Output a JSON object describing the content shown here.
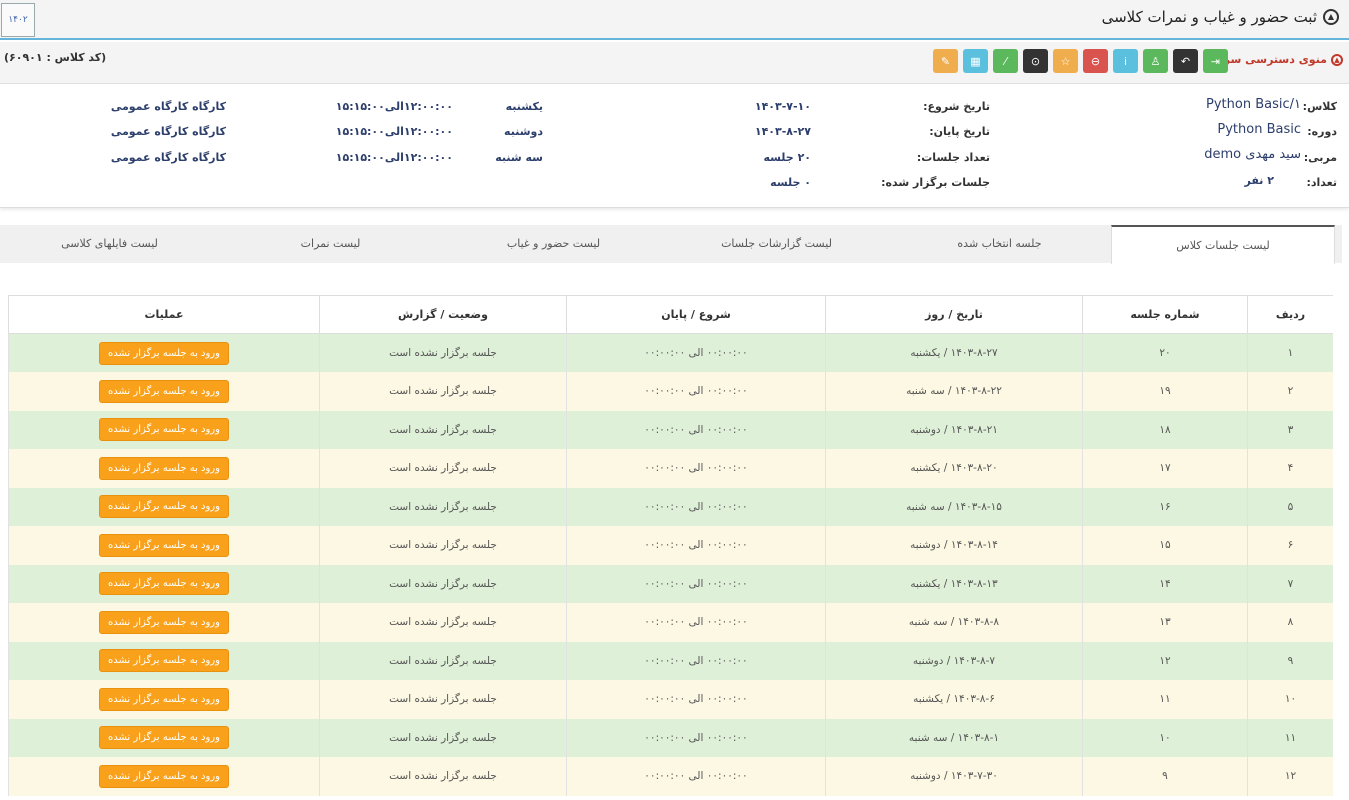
{
  "header": {
    "title": "ثبت حضور و غیاب و نمرات کلاسی",
    "title_icon": "collapse-circle-icon",
    "logo_text": "۱۴۰۲"
  },
  "quick_menu": {
    "label": "منوی دسترسی سریع :",
    "class_code": "(کد کلاس : ۶۰۹۰۱)",
    "buttons": [
      {
        "icon": "sign-in-icon",
        "glyph": "⇥",
        "color": "#5cb85c"
      },
      {
        "icon": "reply-icon",
        "glyph": "↶",
        "color": "#333333"
      },
      {
        "icon": "user-icon",
        "glyph": "♙",
        "color": "#5cb85c"
      },
      {
        "icon": "info-icon",
        "glyph": "i",
        "color": "#5bc0de"
      },
      {
        "icon": "minus-circle-icon",
        "glyph": "⊖",
        "color": "#d9534f"
      },
      {
        "icon": "star-icon",
        "glyph": "☆",
        "color": "#f0ad4e"
      },
      {
        "icon": "clock-icon",
        "glyph": "⊙",
        "color": "#333333"
      },
      {
        "icon": "magic-wand-icon",
        "glyph": "⁄",
        "color": "#5cb85c"
      },
      {
        "icon": "calendar-icon",
        "glyph": "▦",
        "color": "#5bc0de"
      },
      {
        "icon": "edit-icon",
        "glyph": "✎",
        "color": "#f0ad4e"
      }
    ]
  },
  "info": {
    "class_label": "کلاس:",
    "class_value": "Python Basic/۱",
    "course_label": "دوره:",
    "course_value": "Python Basic",
    "teacher_label": "مربی:",
    "teacher_value": "سید مهدی demo",
    "count_label": "تعداد:",
    "count_value": "۲ نفر",
    "start_label": "تاریخ شروع:",
    "start_value": "۱۴۰۳-۷-۱۰",
    "end_label": "تاریخ پایان:",
    "end_value": "۱۴۰۳-۸-۲۷",
    "sessions_label": "تعداد جلسات:",
    "sessions_value": "۲۰ جلسه",
    "held_label": "جلسات برگزار شده:",
    "held_value": "۰ جلسه",
    "schedule": [
      {
        "day": "یکشنبه",
        "time": "۱۲:۰۰:۰۰الی۱۵:۱۵:۰۰",
        "place": "کارگاه کارگاه عمومی"
      },
      {
        "day": "دوشنبه",
        "time": "۱۲:۰۰:۰۰الی۱۵:۱۵:۰۰",
        "place": "کارگاه کارگاه عمومی"
      },
      {
        "day": "سه شنبه",
        "time": "۱۲:۰۰:۰۰الی۱۵:۱۵:۰۰",
        "place": "کارگاه کارگاه عمومی"
      }
    ]
  },
  "tabs": [
    {
      "label": "لیست جلسات کلاس",
      "active": true
    },
    {
      "label": "جلسه انتخاب شده"
    },
    {
      "label": "لیست گزارشات جلسات"
    },
    {
      "label": "لیست حضور و غیاب"
    },
    {
      "label": "لیست نمرات"
    },
    {
      "label": "لیست فایلهای کلاسی"
    }
  ],
  "table": {
    "headers": [
      "ردیف",
      "شماره جلسه",
      "تاریخ / روز",
      "شروع / پایان",
      "وضعیت / گزارش",
      "عملیات"
    ],
    "rows": [
      {
        "row": "۱",
        "num": "۲۰",
        "date": "۱۴۰۳-۸-۲۷ / یکشنبه",
        "time": "۰۰:۰۰:۰۰ الی ۰۰:۰۰:۰۰",
        "status": "جلسه برگزار نشده است",
        "action": "ورود به جلسه برگزار نشده"
      },
      {
        "row": "۲",
        "num": "۱۹",
        "date": "۱۴۰۳-۸-۲۲ / سه شنبه",
        "time": "۰۰:۰۰:۰۰ الی ۰۰:۰۰:۰۰",
        "status": "جلسه برگزار نشده است",
        "action": "ورود به جلسه برگزار نشده"
      },
      {
        "row": "۳",
        "num": "۱۸",
        "date": "۱۴۰۳-۸-۲۱ / دوشنبه",
        "time": "۰۰:۰۰:۰۰ الی ۰۰:۰۰:۰۰",
        "status": "جلسه برگزار نشده است",
        "action": "ورود به جلسه برگزار نشده"
      },
      {
        "row": "۴",
        "num": "۱۷",
        "date": "۱۴۰۳-۸-۲۰ / یکشنبه",
        "time": "۰۰:۰۰:۰۰ الی ۰۰:۰۰:۰۰",
        "status": "جلسه برگزار نشده است",
        "action": "ورود به جلسه برگزار نشده"
      },
      {
        "row": "۵",
        "num": "۱۶",
        "date": "۱۴۰۳-۸-۱۵ / سه شنبه",
        "time": "۰۰:۰۰:۰۰ الی ۰۰:۰۰:۰۰",
        "status": "جلسه برگزار نشده است",
        "action": "ورود به جلسه برگزار نشده"
      },
      {
        "row": "۶",
        "num": "۱۵",
        "date": "۱۴۰۳-۸-۱۴ / دوشنبه",
        "time": "۰۰:۰۰:۰۰ الی ۰۰:۰۰:۰۰",
        "status": "جلسه برگزار نشده است",
        "action": "ورود به جلسه برگزار نشده"
      },
      {
        "row": "۷",
        "num": "۱۴",
        "date": "۱۴۰۳-۸-۱۳ / یکشنبه",
        "time": "۰۰:۰۰:۰۰ الی ۰۰:۰۰:۰۰",
        "status": "جلسه برگزار نشده است",
        "action": "ورود به جلسه برگزار نشده"
      },
      {
        "row": "۸",
        "num": "۱۳",
        "date": "۱۴۰۳-۸-۸ / سه شنبه",
        "time": "۰۰:۰۰:۰۰ الی ۰۰:۰۰:۰۰",
        "status": "جلسه برگزار نشده است",
        "action": "ورود به جلسه برگزار نشده"
      },
      {
        "row": "۹",
        "num": "۱۲",
        "date": "۱۴۰۳-۸-۷ / دوشنبه",
        "time": "۰۰:۰۰:۰۰ الی ۰۰:۰۰:۰۰",
        "status": "جلسه برگزار نشده است",
        "action": "ورود به جلسه برگزار نشده"
      },
      {
        "row": "۱۰",
        "num": "۱۱",
        "date": "۱۴۰۳-۸-۶ / یکشنبه",
        "time": "۰۰:۰۰:۰۰ الی ۰۰:۰۰:۰۰",
        "status": "جلسه برگزار نشده است",
        "action": "ورود به جلسه برگزار نشده"
      },
      {
        "row": "۱۱",
        "num": "۱۰",
        "date": "۱۴۰۳-۸-۱ / سه شنبه",
        "time": "۰۰:۰۰:۰۰ الی ۰۰:۰۰:۰۰",
        "status": "جلسه برگزار نشده است",
        "action": "ورود به جلسه برگزار نشده"
      },
      {
        "row": "۱۲",
        "num": "۹",
        "date": "۱۴۰۳-۷-۳۰ / دوشنبه",
        "time": "۰۰:۰۰:۰۰ الی ۰۰:۰۰:۰۰",
        "status": "جلسه برگزار نشده است",
        "action": "ورود به جلسه برگزار نشده"
      }
    ]
  }
}
